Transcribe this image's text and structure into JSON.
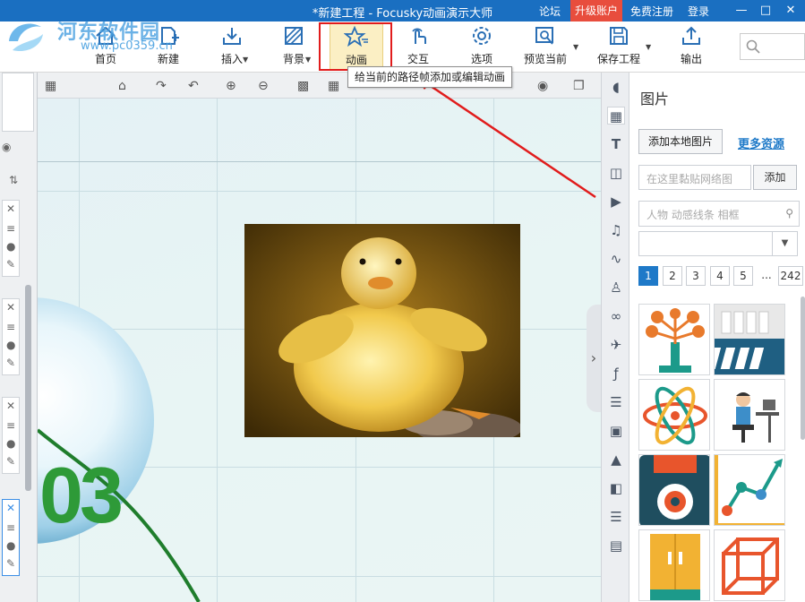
{
  "window": {
    "title": "*新建工程 - Focusky动画演示大师",
    "links": [
      "论坛",
      "升级账户",
      "免费注册",
      "登录"
    ],
    "controls": [
      "minimize",
      "maximize",
      "close"
    ]
  },
  "watermark": {
    "text": "河东软件园",
    "url": "www.pc0359.cn"
  },
  "ribbon": {
    "items": [
      {
        "label": "首页",
        "icon": "home-icon"
      },
      {
        "label": "新建",
        "icon": "new-icon"
      },
      {
        "label": "插入",
        "icon": "insert-icon",
        "dropdown": true
      },
      {
        "label": "背景",
        "icon": "background-icon",
        "dropdown": true
      },
      {
        "label": "动画",
        "icon": "animation-star-icon",
        "active": true
      },
      {
        "label": "交互",
        "icon": "interaction-hand-icon"
      },
      {
        "label": "选项",
        "icon": "gear-icon"
      },
      {
        "label": "预览当前",
        "icon": "preview-icon",
        "dropdown": true
      },
      {
        "label": "保存工程",
        "icon": "save-icon",
        "dropdown": true
      },
      {
        "label": "输出",
        "icon": "export-icon"
      }
    ],
    "search_icon": "search-icon"
  },
  "tooltip": {
    "text": "给当前的路径帧添加或编辑动画"
  },
  "canvas_toolbar": {
    "icons": [
      "ruler-icon",
      "home-icon",
      "redo-icon",
      "undo-icon",
      "zoom-in-icon",
      "zoom-out-icon",
      "lock-icon",
      "grid-icon",
      "camera-icon",
      "layers-icon"
    ]
  },
  "canvas": {
    "big_text": "03",
    "image": "duckling-photo"
  },
  "right_icons": [
    "shape-icon",
    "picture-icon",
    "text-icon",
    "layout-icon",
    "video-icon",
    "music-icon",
    "chart-icon",
    "people-icon",
    "link-icon",
    "plane-icon",
    "flash-icon",
    "list-icon",
    "image-gallery-icon",
    "shirt-icon",
    "template-icon",
    "stack-icon",
    "archive-icon"
  ],
  "panel": {
    "title": "图片",
    "add_local_label": "添加本地图片",
    "more_resources_label": "更多资源",
    "url_placeholder": "在这里黏贴网络图",
    "add_label": "添加",
    "keyword_placeholder": "人物 动感线条 相框",
    "pages": [
      "1",
      "2",
      "3",
      "4",
      "5",
      "...",
      "242"
    ],
    "current_page": "1",
    "thumbnails": [
      "tree-icon",
      "books-icon",
      "atom-icon",
      "office-worker-icon",
      "floppy-disk-icon",
      "line-graph-icon",
      "cabinet-icon",
      "cube-icon"
    ]
  }
}
